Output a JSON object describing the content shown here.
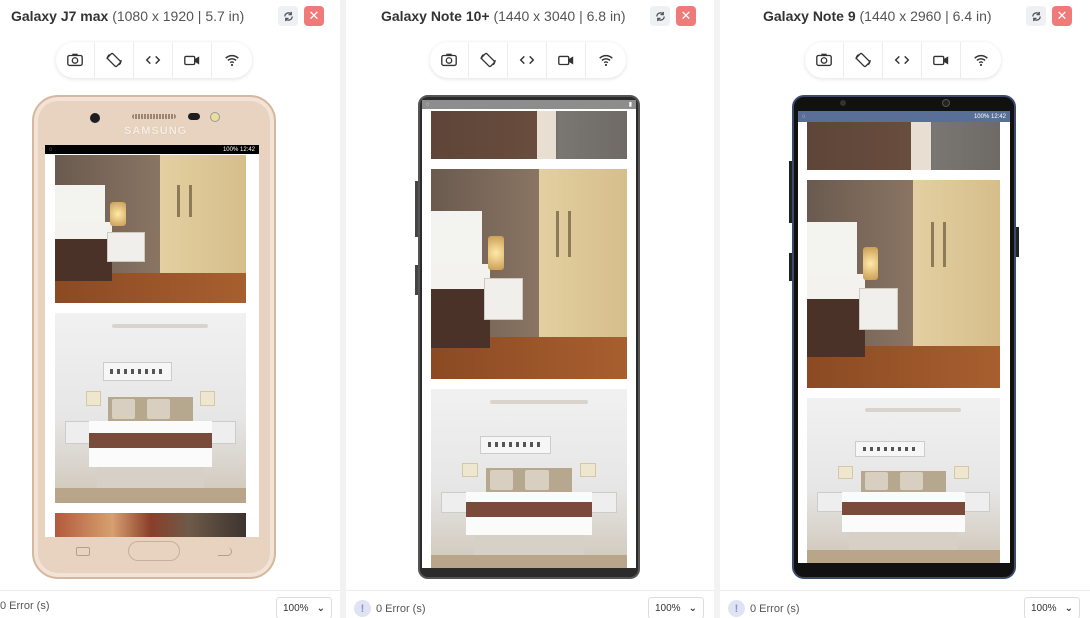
{
  "devices": [
    {
      "name": "Galaxy J7 max",
      "spec": "(1080 x 1920 | 5.7 in)",
      "brand": "SAMSUNG",
      "status_time": "12:42",
      "status_battery": "100%",
      "errors": "0 Error (s)",
      "zoom": "100%"
    },
    {
      "name": "Galaxy Note 10+",
      "spec": "(1440 x 3040 | 6.8 in)",
      "errors": "0 Error (s)",
      "zoom": "100%"
    },
    {
      "name": "Galaxy Note 9",
      "spec": "(1440 x 2960 | 6.4 in)",
      "status_time": "12:42",
      "status_battery": "100%",
      "errors": "0 Error (s)",
      "zoom": "100%"
    }
  ],
  "toolbar_icons": [
    "camera-icon",
    "rotate-screen-icon",
    "code-icon",
    "video-icon",
    "wifi-icon"
  ],
  "colors": {
    "close_button": "#f07a7a",
    "rotate_button": "#eef0f4",
    "j7_body": "#e8d3c0",
    "note_body": "#2b2b2b",
    "note9_statusbar": "#5a6f98"
  }
}
